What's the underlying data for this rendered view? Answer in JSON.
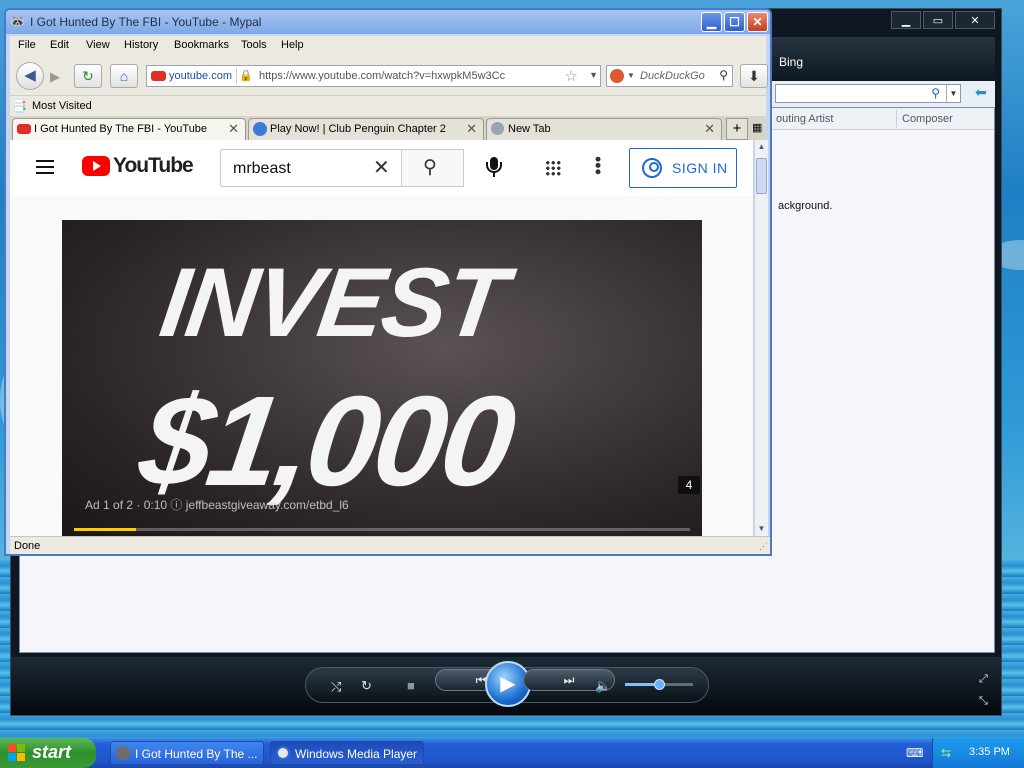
{
  "browser": {
    "title": "I Got Hunted By The FBI - YouTube - Mypal",
    "menu": [
      "File",
      "Edit",
      "View",
      "History",
      "Bookmarks",
      "Tools",
      "Help"
    ],
    "site_badge": "youtube.com",
    "url": "https://www.youtube.com/watch?v=hxwpkM5w3Cc",
    "search_engine_placeholder": "DuckDuckGo",
    "bookmarks_label": "Most Visited",
    "tabs": [
      {
        "label": "I Got Hunted By The FBI - YouTube",
        "active": true
      },
      {
        "label": "Play Now! | Club Penguin Chapter 2",
        "active": false
      },
      {
        "label": "New Tab",
        "active": false
      }
    ],
    "status": "Done"
  },
  "youtube": {
    "wordmark": "YouTube",
    "search_value": "mrbeast",
    "sign_in_label": "SIGN IN",
    "video": {
      "headline_line1": "INVEST",
      "headline_line2": "$1,000",
      "ad_label": "Ad 1 of 2 · 0:10 ⓘ   jeffbeastgiveaway.com/etbd_l6",
      "ad_counter": "4",
      "progress_fraction": 0.1
    }
  },
  "wmp": {
    "bing_label": "Bing",
    "columns": [
      "Contributing Artist",
      "Composer"
    ],
    "visible_columns": [
      "outing Artist",
      "Composer"
    ],
    "background_text": "ackground.",
    "volume_fraction": 0.5
  },
  "taskbar": {
    "start_label": "start",
    "buttons": [
      {
        "label": "I Got Hunted By The ...",
        "active": false
      },
      {
        "label": "Windows Media Player",
        "active": true
      }
    ],
    "clock": "3:35 PM"
  }
}
